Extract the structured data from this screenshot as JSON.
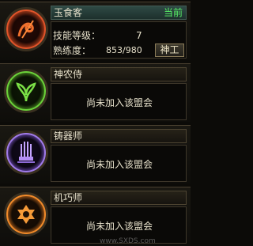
{
  "jobs": [
    {
      "name": "玉食客",
      "status": "当前",
      "level_label": "技能等级：",
      "level_value": "7",
      "prof_label": "熟练度：",
      "prof_value": "853/980",
      "button": "神工",
      "icon": "cooking-emblem-icon",
      "color": "#e0542a"
    },
    {
      "name": "神农侍",
      "message": "尚未加入该盟会",
      "icon": "herb-emblem-icon",
      "color": "#6bd13a"
    },
    {
      "name": "铸器师",
      "message": "尚未加入该盟会",
      "icon": "forge-emblem-icon",
      "color": "#a07be8"
    },
    {
      "name": "机巧师",
      "message": "尚未加入该盟会",
      "icon": "gear-emblem-icon",
      "color": "#f08a2a"
    }
  ],
  "watermark": {
    "text": "www.SXDS.com"
  }
}
